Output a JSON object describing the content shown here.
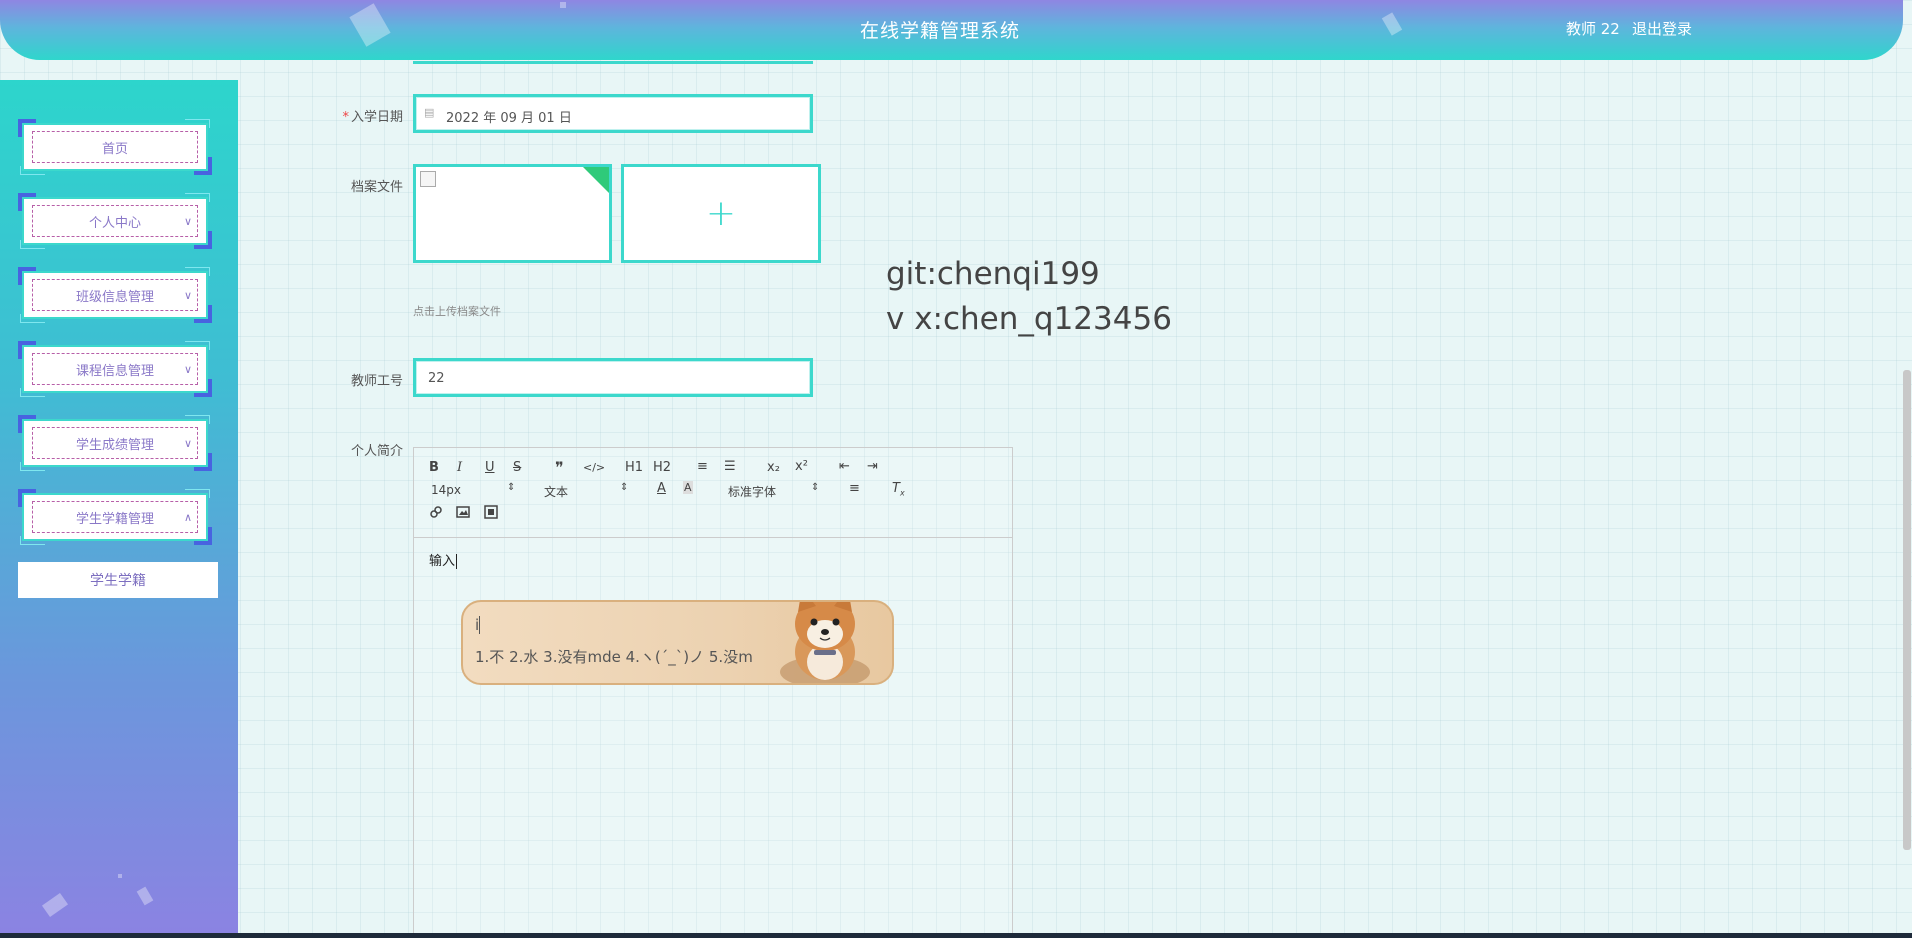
{
  "header": {
    "title": "在线学籍管理系统",
    "user": "教师 22",
    "logout": "退出登录"
  },
  "sidebar": {
    "items": [
      {
        "label": "首页",
        "chevron": ""
      },
      {
        "label": "个人中心",
        "chevron": "∨"
      },
      {
        "label": "班级信息管理",
        "chevron": "∨"
      },
      {
        "label": "课程信息管理",
        "chevron": "∨"
      },
      {
        "label": "学生成绩管理",
        "chevron": "∨"
      },
      {
        "label": "学生学籍管理",
        "chevron": "∧"
      }
    ],
    "submenu": "学生学籍"
  },
  "form": {
    "enroll_date": {
      "label": "入学日期",
      "required": "*",
      "value": "2022 年 09 月 01 日"
    },
    "archive": {
      "label": "档案文件",
      "hint": "点击上传档案文件",
      "plus": "+"
    },
    "teacher_id": {
      "label": "教师工号",
      "value": "22"
    },
    "intro": {
      "label": "个人简介"
    }
  },
  "overlay": {
    "line1": "git:chenqi199",
    "line2": "v x:chen_q123456"
  },
  "editor": {
    "toolbar": {
      "row1": [
        "B",
        "I",
        "U",
        "S",
        "❞",
        "</>",
        "H1",
        "H2",
        "≡",
        "☰",
        "x₂",
        "x²",
        "⇤",
        "⇥"
      ],
      "font_size": "14px",
      "header": "文本",
      "font_family": "标准字体",
      "row3": [
        "link-icon",
        "image-icon",
        "video-icon"
      ]
    },
    "content": "输入"
  },
  "ime": {
    "composition": "i",
    "candidates": "1.不  2.水  3.没有mde  4.ヽ(ˊ_ˋ)ノ  5.没m"
  },
  "colors": {
    "accent": "#3cd8cc",
    "header_start": "#8f86e2",
    "header_end": "#2fd6cc",
    "menu_corner": "#4863e0",
    "upload_corner": "#2fca7a"
  }
}
